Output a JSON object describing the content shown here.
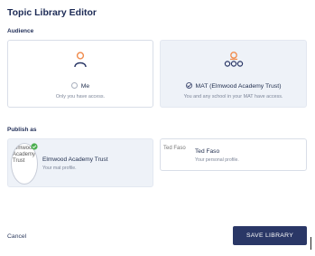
{
  "header": {
    "title": "Topic Library Editor"
  },
  "audience": {
    "label": "Audience",
    "options": [
      {
        "title": "Me",
        "subtitle": "Only you have access.",
        "selected": false
      },
      {
        "title": "MAT (Elmwood Academy Trust)",
        "subtitle": "You and any school in your MAT have access.",
        "selected": true
      }
    ]
  },
  "publish": {
    "label": "Publish as",
    "options": [
      {
        "img_alt": "Elmwood Academy Trust",
        "name": "Elmwood Academy Trust",
        "subtitle": "Your mat profile.",
        "selected": true
      },
      {
        "img_alt": "Ted Faso",
        "name": "Ted Faso",
        "subtitle": "Your personal profile.",
        "selected": false
      }
    ]
  },
  "footer": {
    "cancel_label": "Cancel",
    "save_label": "SAVE LIBRARY"
  },
  "colors": {
    "accent_orange": "#f08a4b",
    "primary_navy": "#2a3766",
    "selected_bg": "#eef2f8",
    "check_green": "#4caf50"
  }
}
